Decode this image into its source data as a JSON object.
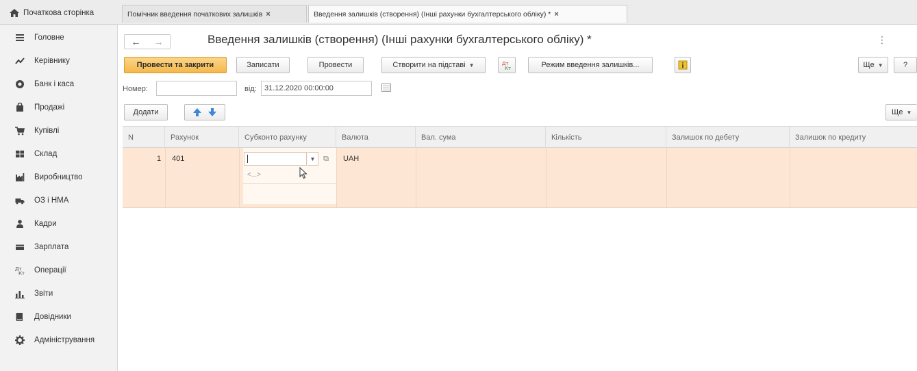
{
  "tabs": {
    "home_label": "Початкова сторінка",
    "items": [
      {
        "label": "Помічник введення початкових залишків",
        "close": "×"
      },
      {
        "label": "Введення залишків (створення) (Інші рахунки бухгалтерського обліку) *",
        "close": "×"
      }
    ]
  },
  "sidebar": {
    "items": [
      {
        "label": "Головне",
        "icon": "menu-icon"
      },
      {
        "label": "Керівнику",
        "icon": "chart-line-icon"
      },
      {
        "label": "Банк і каса",
        "icon": "money-icon"
      },
      {
        "label": "Продажі",
        "icon": "bag-icon"
      },
      {
        "label": "Купівлі",
        "icon": "cart-icon"
      },
      {
        "label": "Склад",
        "icon": "warehouse-icon"
      },
      {
        "label": "Виробництво",
        "icon": "factory-icon"
      },
      {
        "label": "ОЗ і НМА",
        "icon": "truck-icon"
      },
      {
        "label": "Кадри",
        "icon": "person-icon"
      },
      {
        "label": "Зарплата",
        "icon": "wallet-icon"
      },
      {
        "label": "Операції",
        "icon": "operations-icon"
      },
      {
        "label": "Звіти",
        "icon": "bar-chart-icon"
      },
      {
        "label": "Довідники",
        "icon": "book-icon"
      },
      {
        "label": "Адміністрування",
        "icon": "gear-icon"
      }
    ]
  },
  "header": {
    "back": "←",
    "forward": "→",
    "title": "Введення залишків (створення) (Інші рахунки бухгалтерського обліку) *",
    "more_icon": "⋮"
  },
  "toolbar": {
    "post_close": "Провести та закрити",
    "save": "Записати",
    "post": "Провести",
    "create_based": "Створити на підставі",
    "mode": "Режим введення залишків...",
    "more": "Ще",
    "help": "?"
  },
  "form": {
    "number_label": "Номер:",
    "number_value": "",
    "date_label": "від:",
    "date_value": "31.12.2020 00:00:00"
  },
  "table_toolbar": {
    "add": "Додати",
    "more": "Ще"
  },
  "table": {
    "columns": [
      "N",
      "Рахунок",
      "Субконто рахунку",
      "Валюта",
      "Вал. сума",
      "Кількість",
      "Залишок по дебету",
      "Залишок по кредиту"
    ],
    "rows": [
      {
        "n": "1",
        "account": "401",
        "subconto": "",
        "subconto_empty": "<...>",
        "currency": "UAH"
      }
    ]
  }
}
